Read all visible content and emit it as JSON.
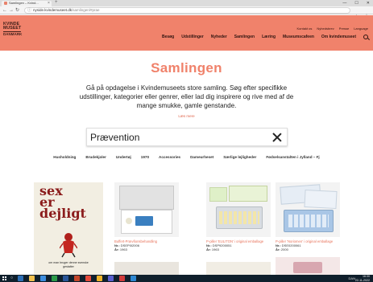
{
  "browser": {
    "tab_title": "Samlingen – Kvind...",
    "url_host": "nyside.kvindemuseet.dk",
    "url_path": "/samlingen/#prae",
    "window_controls": [
      "—",
      "☐",
      "✕"
    ]
  },
  "header": {
    "logo_lines": [
      "KVINDE",
      "MUSEET",
      "DANMARK"
    ],
    "util_links": [
      "Kontakt os",
      "Nyhedsbrev",
      "Presse",
      "Language"
    ],
    "nav": [
      "Besøg",
      "Udstillinger",
      "Nyheder",
      "Samlingen",
      "Læring",
      "Museumscafeen",
      "Om kvindemuseet"
    ]
  },
  "hero": {
    "title": "Samlingen",
    "intro": "Gå på opdagelse i Kvindemuseets store samling. Søg efter specifikke udstillinger, kategorier eller genrer, eller lad dig inspirere og rive med af de mange smukke, gamle genstande.",
    "read_more": "Læs mere"
  },
  "search": {
    "value": "Prævention",
    "placeholder": ""
  },
  "categories": [
    "Husholdning",
    "Brudekjoler",
    "Undertøj",
    "1970",
    "Accessories",
    "Dameurheset",
    "Særlige lejligheder",
    "Fødselsanstalten i Jylland – Fj"
  ],
  "cards": [
    {
      "book_title": "sex\ner\ndejligt",
      "book_caption": "om man bruger denne svenske gestalter",
      "title": "",
      "number_label": "",
      "number": "",
      "year_label": "",
      "year": ""
    },
    {
      "title": "Buffert-Prævfionsbehandling",
      "number_label": "Nr.:",
      "number": "DSEP0I2006",
      "year_label": "År:",
      "year": "1963"
    },
    {
      "title": "P-piller 'EULITON' i original emballage",
      "number_label": "Nr.:",
      "number": "DSP9200051",
      "year_label": "År:",
      "year": "1963"
    },
    {
      "title": "P-piller 'Noriomen' i original emballage",
      "number_label": "Nr.:",
      "number": "DSE0200061",
      "year_label": "År:",
      "year": "2000"
    }
  ],
  "taskbar": {
    "time": "16:30",
    "date": "22-11-2022",
    "tray_text": "DAN"
  },
  "colors": {
    "brand": "#f0826b",
    "brand_dark": "#2e1410",
    "link": "#e8735b",
    "taskbar": "#0f1f2c"
  }
}
